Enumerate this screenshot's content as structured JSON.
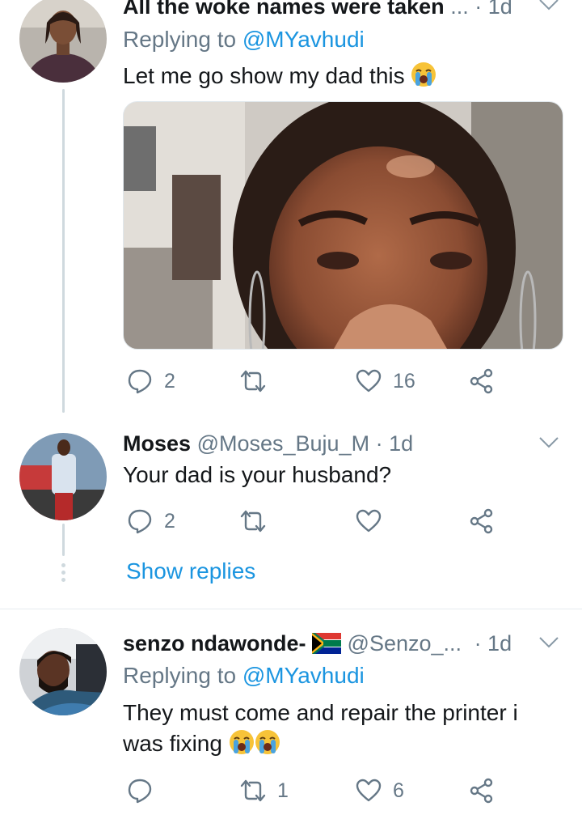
{
  "tweets": [
    {
      "display_name": "All the woke names were taken",
      "name_truncation": "...",
      "time": "· 1d",
      "replying_to_prefix": "Replying to",
      "replying_to_handle": "@MYavhudi",
      "text": "Let me go show my dad this",
      "text_emoji": "loudly-crying-face",
      "actions": {
        "reply_count": "2",
        "retweet_count": "",
        "like_count": "16"
      }
    },
    {
      "display_name": "Moses",
      "handle": "@Moses_Buju_M",
      "time": "· 1d",
      "text": "Your dad is your husband?",
      "actions": {
        "reply_count": "2",
        "retweet_count": "",
        "like_count": ""
      },
      "show_replies": "Show replies"
    },
    {
      "display_name": "senzo ndawonde-",
      "flag": "south-africa-flag",
      "handle": "@Senzo_...",
      "time": "· 1d",
      "replying_to_prefix": "Replying to",
      "replying_to_handle": "@MYavhudi",
      "text_line1": "They must come and repair the printer i",
      "text_line2": "was fixing",
      "text_emojis": [
        "loudly-crying-face",
        "loudly-crying-face"
      ],
      "actions": {
        "reply_count": "",
        "retweet_count": "1",
        "like_count": "6"
      }
    }
  ],
  "colors": {
    "accent": "#1b95e0",
    "muted": "#657786",
    "text": "#14171a",
    "thread_line": "#cfd9de"
  }
}
